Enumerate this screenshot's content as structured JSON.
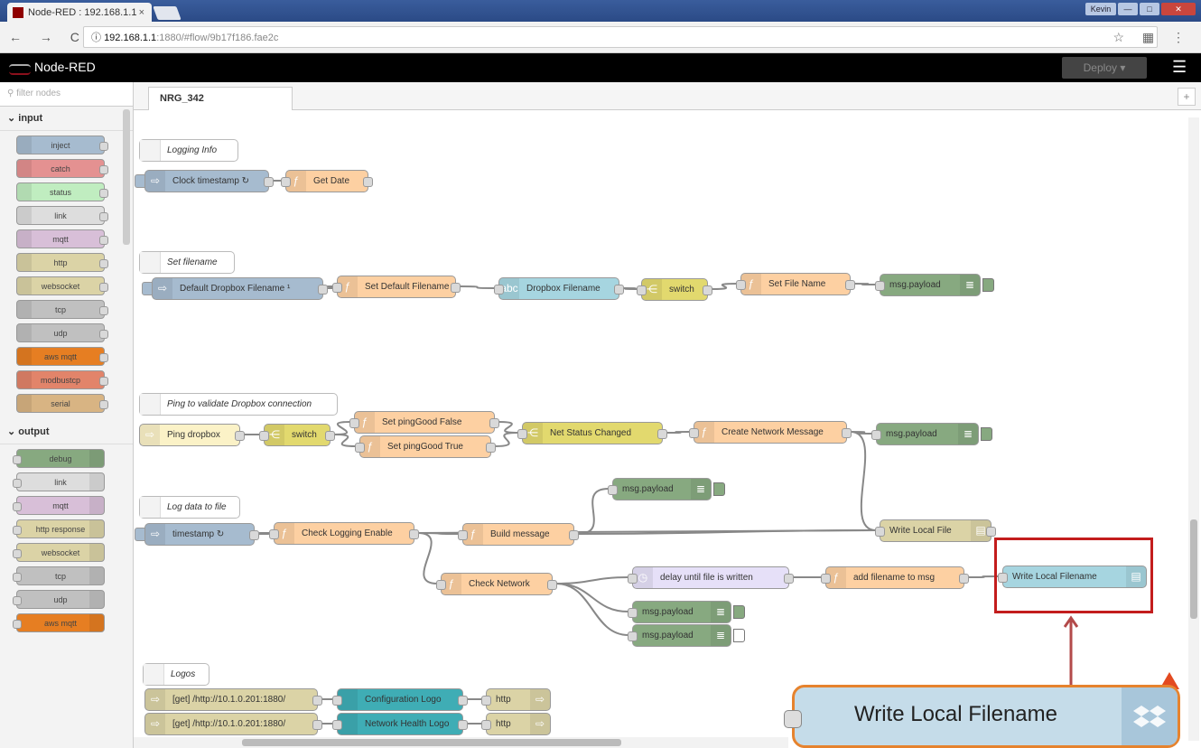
{
  "browser": {
    "tab_title": "Node-RED : 192.168.1.1",
    "tab_close": "×",
    "window_buttons": [
      "Kevin",
      "—",
      "□",
      "✕"
    ],
    "nav_glyphs": "← → C ⌂",
    "url_host": "192.168.1.1",
    "url_path": ":1880/#flow/9b17f186.fae2c",
    "right_glyphs": "☆ ▦ ⋮"
  },
  "header": {
    "title": "Node-RED",
    "deploy_label": "Deploy",
    "menu_icon": "☰"
  },
  "palette": {
    "filter_placeholder": "filter nodes",
    "input_label": "input",
    "input_nodes": [
      "inject",
      "catch",
      "status",
      "link",
      "mqtt",
      "http",
      "websocket",
      "tcp",
      "udp",
      "aws mqtt",
      "modbustcp",
      "serial"
    ],
    "output_label": "output",
    "output_nodes": [
      "debug",
      "link",
      "mqtt",
      "http response",
      "websocket",
      "tcp",
      "udp",
      "aws mqtt"
    ]
  },
  "workspace": {
    "flow_tab": "NRG_342",
    "add_icon": "+"
  },
  "nodes": {
    "c_logging": "Logging Info",
    "clock": "Clock timestamp ↻",
    "getdate": "Get Date",
    "c_setfile": "Set filename",
    "defdrop": "Default Dropbox Filename ¹",
    "setdef": "Set Default Filename",
    "dropfile": "Dropbox Filename",
    "switch1": "switch",
    "setname": "Set File Name",
    "msg1": "msg.payload",
    "c_ping": "Ping to validate Dropbox connection",
    "pingdrop": "Ping dropbox",
    "switch2": "switch",
    "pingfalse": "Set pingGood False",
    "pingtrue": "Set pingGood True",
    "netstatus": "Net Status Changed",
    "createnet": "Create Network Message",
    "msg2": "msg.payload",
    "c_logdata": "Log data to file",
    "timestamp": "timestamp ↻",
    "checklog": "Check Logging Enable",
    "buildmsg": "Build message",
    "msg3": "msg.payload",
    "writelocal": "Write Local File",
    "checknet": "Check Network",
    "delay": "delay until file is written",
    "addfile": "add filename to msg",
    "writelocalfn": "Write Local Filename",
    "msg4": "msg.payload",
    "msg5": "msg.payload",
    "c_logos": "Logos",
    "get1": "[get] /http://10.1.0.201:1880/",
    "conflogo": "Configuration Logo",
    "http1": "http",
    "get2": "[get] /http://10.1.0.201:1880/",
    "netlogo": "Network Health Logo",
    "http2": "http"
  },
  "callout": {
    "label": "Write Local Filename"
  },
  "colors": {
    "inject": "#a6bbcf",
    "function": "#fdd0a2",
    "switch": "#e2d96e",
    "debug": "#87a980",
    "storage": "#dbd3a6",
    "delay": "#e6e0f8",
    "change": "#a6d5e0",
    "template": "#3fadb5",
    "highlight": "#c31d1d",
    "callout_border": "#e6832e"
  }
}
